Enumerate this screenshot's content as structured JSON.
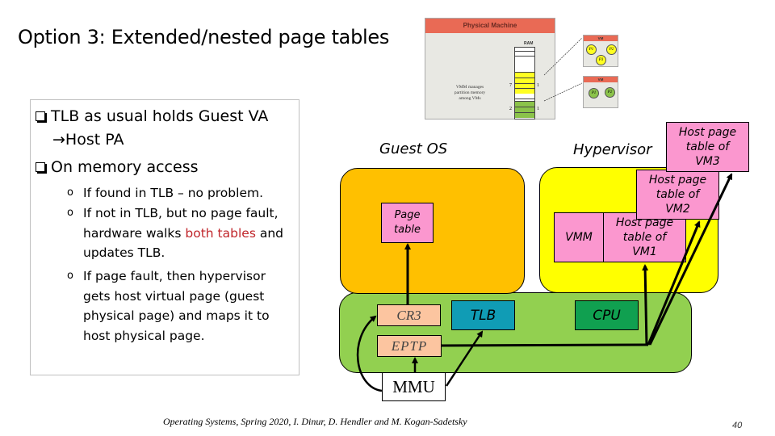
{
  "slide": {
    "title": "Option 3: Extended/nested page tables",
    "page_number": "40",
    "footer": "Operating Systems, Spring 2020, I. Dinur, D. Hendler and M. Kogan-Sadetsky"
  },
  "bullets": {
    "items": [
      {
        "line1": "TLB as usual holds Guest VA",
        "line2_arrow": "→",
        "line2": "Host PA"
      },
      {
        "line1": "On memory access"
      }
    ],
    "subitems": [
      {
        "text": "If found in TLB – no problem."
      },
      {
        "text_a": "If not in TLB, but no page fault,",
        "text_b_pre": "hardware walks ",
        "text_b_red": "both tables",
        "text_b_post": " and",
        "text_c": "updates TLB."
      },
      {
        "lines": [
          "If page fault, then hypervisor",
          "gets host virtual page (guest",
          "physical page) and maps it to",
          "host physical page."
        ]
      }
    ],
    "highlight_color": "#c0262b"
  },
  "thumbnail": {
    "header": "Physical Machine",
    "ram_label": "RAM",
    "note": "VMM manages partition memory among VMs",
    "mark_7": "7",
    "mark_2": "2",
    "mark_1a": "1",
    "mark_1b": "1",
    "vm1": {
      "header": "VM",
      "procs": [
        "P1",
        "P2",
        "P3"
      ]
    },
    "vm2": {
      "header": "VM",
      "procs": [
        "P1",
        "P2"
      ]
    }
  },
  "diagram": {
    "guest_os_label": "Guest OS",
    "hypervisor_label": "Hypervisor",
    "page_table": "Page table",
    "vmm": "VMM",
    "host_pt_vm1": "Host page table of VM1",
    "host_pt_vm2": "Host page table of VM2",
    "host_pt_vm3": "Host page table of VM3",
    "cr3": "CR3",
    "eptp": "EPTP",
    "tlb": "TLB",
    "cpu": "CPU",
    "mmu": "MMU",
    "colors": {
      "guest_os": "#ffc000",
      "hypervisor": "#ffff00",
      "hardware": "#92d050",
      "table_pink": "#fb97cf",
      "register": "#fcc5a0",
      "tlb": "#109cb5",
      "cpu": "#10a050"
    }
  }
}
